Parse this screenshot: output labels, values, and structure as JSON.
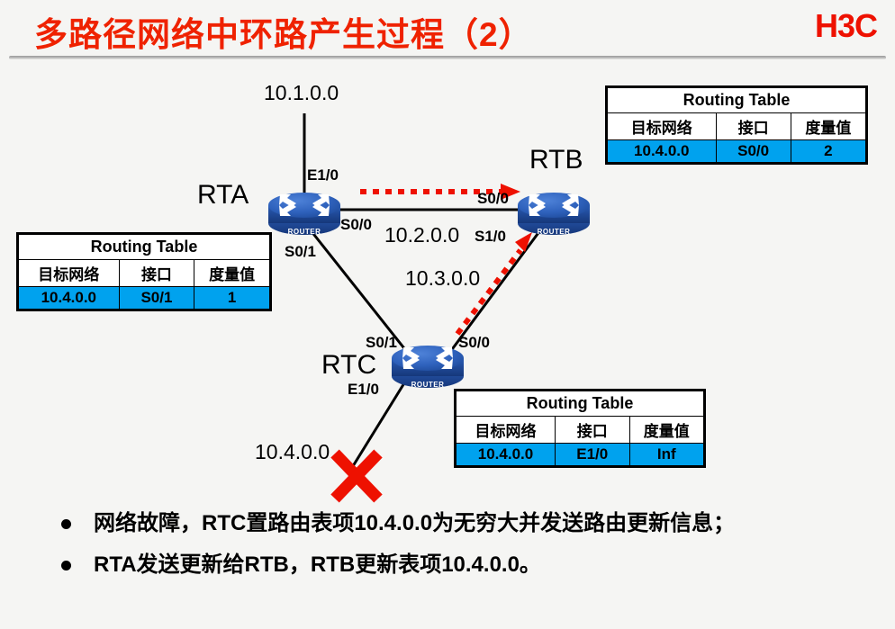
{
  "header": {
    "title": "多路径网络中环路产生过程（2）",
    "logo": "H3C"
  },
  "diagram": {
    "networks": [
      {
        "name": "net-10-1-0-0",
        "text": "10.1.0.0"
      },
      {
        "name": "net-10-2-0-0",
        "text": "10.2.0.0"
      },
      {
        "name": "net-10-3-0-0",
        "text": "10.3.0.0"
      },
      {
        "name": "net-10-4-0-0",
        "text": "10.4.0.0"
      }
    ],
    "routers": [
      {
        "name": "RTA",
        "label": "ROUTER"
      },
      {
        "name": "RTB",
        "label": "ROUTER"
      },
      {
        "name": "RTC",
        "label": "ROUTER"
      }
    ],
    "interfaces": {
      "rta_e1_0": "E1/0",
      "rta_s0_0": "S0/0",
      "rta_s0_1": "S0/1",
      "rtb_s0_0": "S0/0",
      "rtb_s1_0": "S1/0",
      "rtc_s0_1": "S0/1",
      "rtc_s0_0": "S0/0",
      "rtc_e1_0": "E1/0"
    },
    "router_names": {
      "rta": "RTA",
      "rtb": "RTB",
      "rtc": "RTC"
    },
    "link_failure_marker": "X"
  },
  "tables": [
    {
      "name": "routing-table-rta",
      "title": "Routing Table",
      "headers": [
        "目标网络",
        "接口",
        "度量值"
      ],
      "rows": [
        [
          "10.4.0.0",
          "S0/1",
          "1"
        ]
      ],
      "row_bg": "#00a2ee"
    },
    {
      "name": "routing-table-rtb",
      "title": "Routing Table",
      "headers": [
        "目标网络",
        "接口",
        "度量值"
      ],
      "rows": [
        [
          "10.4.0.0",
          "S0/0",
          "2"
        ]
      ],
      "row_bg": "#00a2ee"
    },
    {
      "name": "routing-table-rtc",
      "title": "Routing Table",
      "headers": [
        "目标网络",
        "接口",
        "度量值"
      ],
      "rows": [
        [
          "10.4.0.0",
          "E1/0",
          "Inf"
        ]
      ],
      "row_bg": "#00a2ee"
    }
  ],
  "bullets": [
    "网络故障，RTC置路由表项10.4.0.0为无穷大并发送路由更新信息；",
    "RTA发送更新给RTB，RTB更新表项10.4.0.0。"
  ],
  "colors": {
    "title_red": "#ef2200",
    "logo_red": "#ee1100",
    "table_highlight": "#00a2ee",
    "router_blue": "#2a5fbd",
    "arrow_red": "#ee1100",
    "background": "#f5f5f3"
  }
}
